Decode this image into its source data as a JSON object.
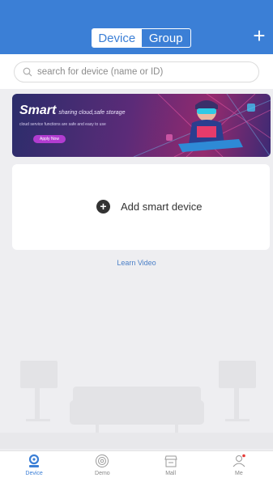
{
  "header": {
    "tabs": [
      {
        "label": "Device",
        "active": true
      },
      {
        "label": "Group",
        "active": false
      }
    ],
    "add_icon": "plus-icon"
  },
  "search": {
    "placeholder": "search for device (name or ID)",
    "icon": "search-icon"
  },
  "banner": {
    "title": "Smart",
    "subtitle": "sharing cloud,safe storage",
    "description": "cloud service functions are safe and easy to use",
    "button": "Apply Now"
  },
  "add_card": {
    "label": "Add smart device",
    "icon": "add-circle-icon"
  },
  "learn_video": "Learn Video",
  "tabbar": [
    {
      "label": "Device",
      "icon": "device-icon",
      "active": true
    },
    {
      "label": "Demo",
      "icon": "demo-icon",
      "active": false
    },
    {
      "label": "Mall",
      "icon": "mall-icon",
      "active": false
    },
    {
      "label": "Me",
      "icon": "me-icon",
      "active": false,
      "badge": true
    }
  ],
  "colors": {
    "primary": "#3b7fd6",
    "background": "#eeeef1",
    "badge": "#e53935"
  }
}
